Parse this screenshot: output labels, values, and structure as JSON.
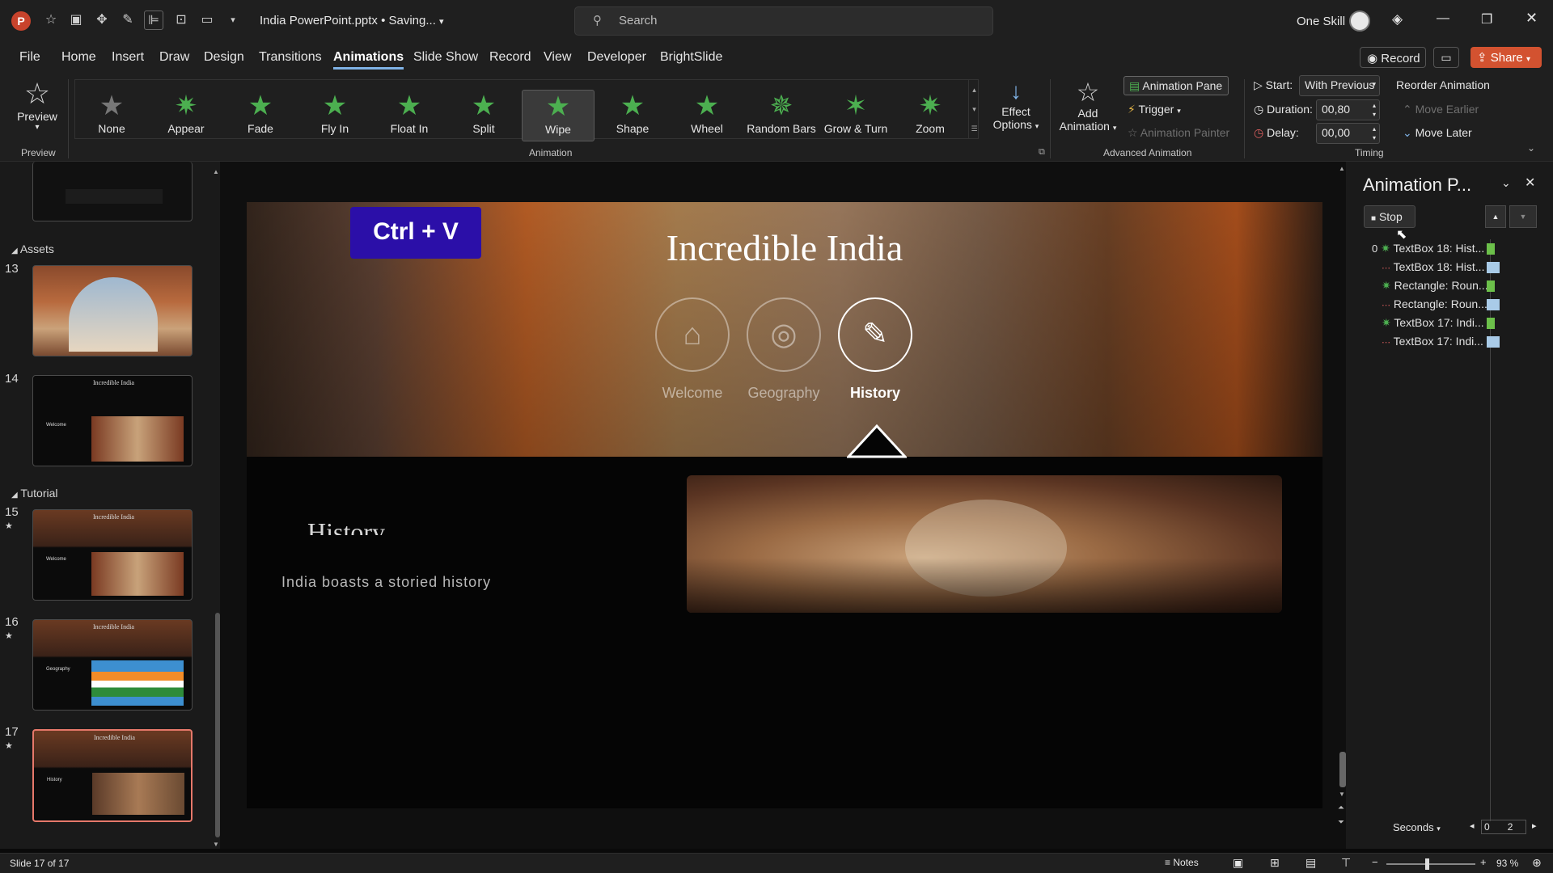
{
  "titlebar": {
    "app_logo": "P",
    "doc_title": "India PowerPoint.pptx • Saving...",
    "search_placeholder": "Search",
    "user_name": "One Skill"
  },
  "menu": {
    "tabs": [
      "File",
      "Home",
      "Insert",
      "Draw",
      "Design",
      "Transitions",
      "Animations",
      "Slide Show",
      "Record",
      "View",
      "Developer",
      "BrightSlide"
    ],
    "record": "Record",
    "share": "Share"
  },
  "ribbon": {
    "preview": "Preview",
    "animations": [
      "None",
      "Appear",
      "Fade",
      "Fly In",
      "Float In",
      "Split",
      "Wipe",
      "Shape",
      "Wheel",
      "Random Bars",
      "Grow & Turn",
      "Zoom"
    ],
    "effect_options_1": "Effect",
    "effect_options_2": "Options",
    "add_animation_1": "Add",
    "add_animation_2": "Animation",
    "animation_pane": "Animation Pane",
    "trigger": "Trigger",
    "animation_painter": "Animation Painter",
    "start_label": "Start:",
    "start_value": "With Previous",
    "duration_label": "Duration:",
    "duration_value": "00,80",
    "delay_label": "Delay:",
    "delay_value": "00,00",
    "reorder": "Reorder Animation",
    "move_earlier": "Move Earlier",
    "move_later": "Move Later",
    "groups": {
      "preview": "Preview",
      "animation": "Animation",
      "advanced": "Advanced Animation",
      "timing": "Timing"
    }
  },
  "slides_pane": {
    "section_assets": "Assets",
    "section_tutorial": "Tutorial",
    "numbers": [
      "13",
      "14",
      "15",
      "16",
      "17"
    ],
    "thumb_title": "Incredible India",
    "thumb_welcome": "Welcome",
    "thumb_geography": "Geography",
    "thumb_history": "History"
  },
  "slide": {
    "shortcut_badge": "Ctrl + V",
    "title": "Incredible India",
    "nav": [
      "Welcome",
      "Geography",
      "History"
    ],
    "section_heading": "History",
    "body": "India boasts a storied history"
  },
  "anim_pane": {
    "title": "Animation P...",
    "stop": "Stop",
    "first_index": "0",
    "items": [
      "TextBox 18: Hist...",
      "TextBox 18: Hist...",
      "Rectangle: Roun...",
      "Rectangle: Roun...",
      "TextBox 17: Indi...",
      "TextBox 17: Indi..."
    ],
    "seconds": "Seconds",
    "timeline_0": "0",
    "timeline_2": "2"
  },
  "statusbar": {
    "slide_info": "Slide 17 of 17",
    "notes": "Notes",
    "zoom": "93 %"
  },
  "colors": {
    "accent": "#7fb2e5",
    "anim_green": "#4caf50",
    "share": "#d35230",
    "badge": "#2b0fa8",
    "selected_thumb": "#e6786a"
  }
}
